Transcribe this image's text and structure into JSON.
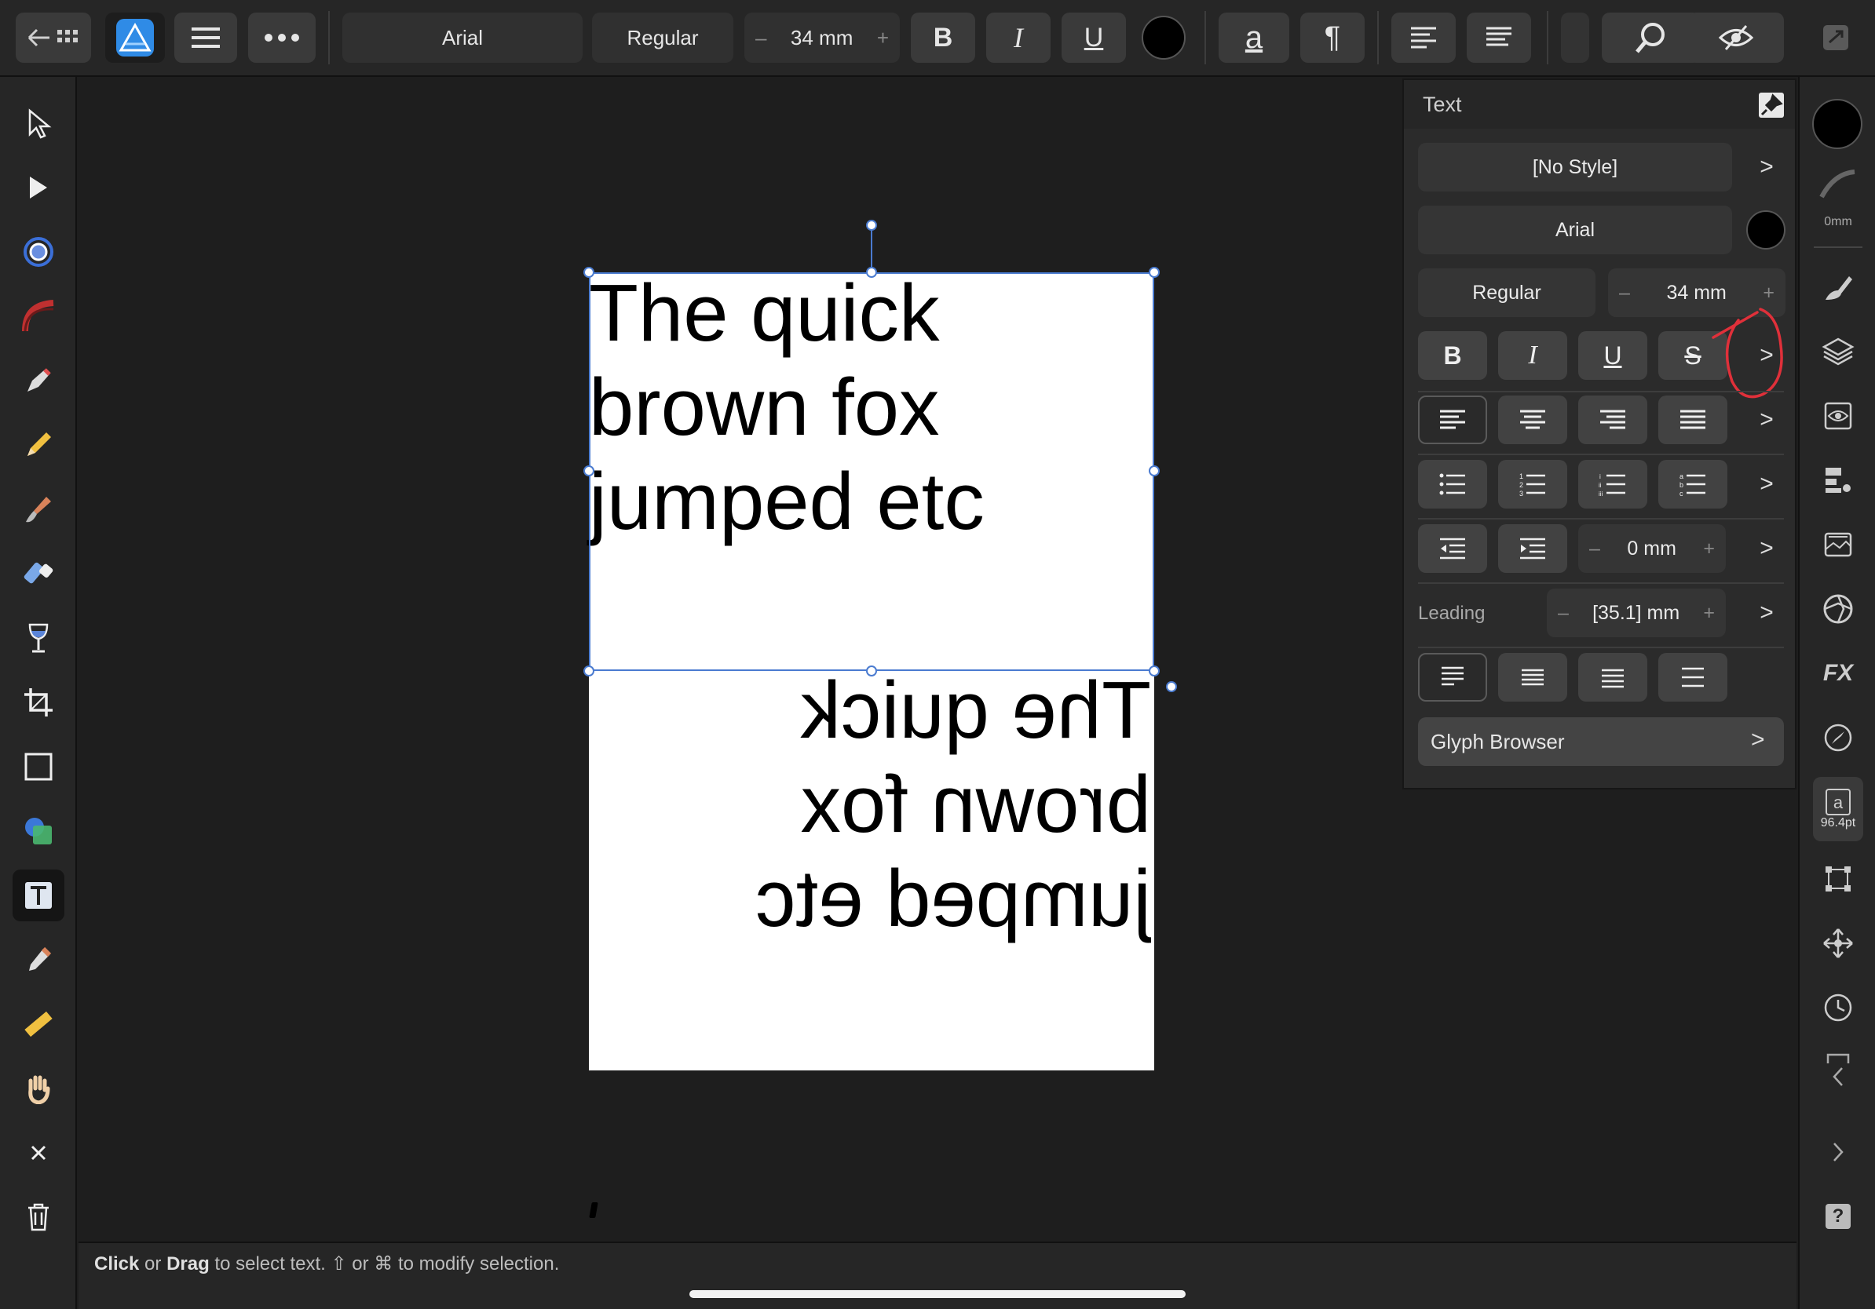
{
  "toolbar": {
    "font_family": "Arial",
    "font_style": "Regular",
    "font_size": "34 mm",
    "minus": "–",
    "plus": "+",
    "bold": "B",
    "italic": "I",
    "underline": "U",
    "text_color": "#000000",
    "char_icon": "a",
    "para_icon": "¶"
  },
  "panel": {
    "title": "Text",
    "style": "[No Style]",
    "font_family": "Arial",
    "font_color": "#000000",
    "font_style": "Regular",
    "font_size": "34 mm",
    "minus": "–",
    "plus": "+",
    "bold": "B",
    "italic": "I",
    "underline": "U",
    "strike": "S",
    "indent_value": "0 mm",
    "leading_label": "Leading",
    "leading_value": "[35.1] mm",
    "glyph_browser": "Glyph Browser",
    "chevron": ">"
  },
  "canvas": {
    "text_lines": [
      "The quick",
      "brown fox",
      "jumped etc"
    ],
    "mirrored_lines": [
      "The quick",
      "brown fox",
      "jumped etc"
    ]
  },
  "right_strip": {
    "stroke_width": "0mm",
    "text_size_badge": "96.4pt",
    "help": "?"
  },
  "status": {
    "click": "Click",
    "or1": " or ",
    "drag": "Drag",
    "rest": " to select text. ⇧ or ⌘ to modify selection."
  },
  "colors": {
    "annotation": "#e0303a",
    "selection": "#4a7bd0",
    "accent": "#2f8be6"
  }
}
